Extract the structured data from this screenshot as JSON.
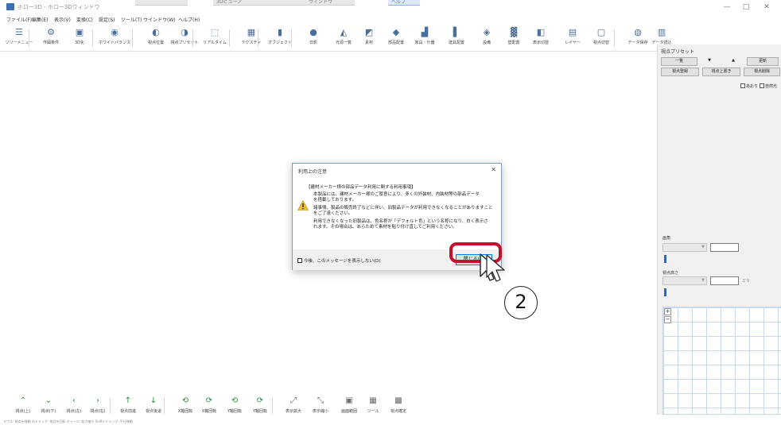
{
  "window": {
    "title": "ホロー3D - ホロー3Dウィンドウ",
    "peek_tabs": [
      "3Dビューア",
      "ウィンドウ",
      "ヘルプ"
    ],
    "controls": [
      "—",
      "□",
      "✕"
    ]
  },
  "menu": [
    "ファイル(F)",
    "編集(E)",
    "表示(V)",
    "変換(C)",
    "設定(S)",
    "ツール(T)",
    "ウインドウ(W)",
    "ヘルプ(H)"
  ],
  "toolbar": {
    "buttons": [
      {
        "icon": "menu-icon",
        "glyph": "☰",
        "label": "ツリーメニュー"
      },
      {
        "icon": "settings-icon",
        "glyph": "⚙",
        "label": "作図条件"
      },
      {
        "icon": "3d-icon",
        "glyph": "▣",
        "label": "3D化"
      },
      {
        "icon": "camera-icon",
        "glyph": "◉",
        "label": "ホワイトバランス"
      },
      {
        "icon": "viewpoint-icon",
        "glyph": "◐",
        "label": "視点位置"
      },
      {
        "icon": "preset-icon",
        "glyph": "◑",
        "label": "視点プリセット"
      },
      {
        "icon": "preview-icon",
        "glyph": "⬚",
        "label": "リアルタイム"
      },
      {
        "icon": "texture-icon",
        "glyph": "▦",
        "label": "テクスチャ"
      },
      {
        "icon": "object-icon",
        "glyph": "▮",
        "label": "オブジェクト"
      },
      {
        "icon": "sun-icon",
        "glyph": "●",
        "label": "日影"
      },
      {
        "icon": "light-icon",
        "glyph": "◭",
        "label": "光源一覧"
      },
      {
        "icon": "material-icon",
        "glyph": "◩",
        "label": "素材"
      },
      {
        "icon": "parts-icon",
        "glyph": "◆",
        "label": "部品配置"
      },
      {
        "icon": "furniture-icon",
        "glyph": "▟",
        "label": "家具・什器"
      },
      {
        "icon": "fitting-icon",
        "glyph": "▌",
        "label": "建具配置"
      },
      {
        "icon": "equipment-icon",
        "glyph": "◈",
        "label": "設備"
      },
      {
        "icon": "wall-icon",
        "glyph": "▓",
        "label": "壁配置"
      },
      {
        "icon": "display-icon",
        "glyph": "◧",
        "label": "表示切替"
      },
      {
        "icon": "layer-icon",
        "glyph": "▤",
        "label": "レイヤー"
      },
      {
        "icon": "save-view-icon",
        "glyph": "▢",
        "label": "視点切替"
      },
      {
        "icon": "data-save-icon",
        "glyph": "◍",
        "label": "データ保存"
      },
      {
        "icon": "data-load-icon",
        "glyph": "▥",
        "label": "データ読込"
      }
    ]
  },
  "right_panel": {
    "header": "視点プリセット",
    "buttons": {
      "prev": "一覧",
      "down": "▼",
      "up": "▲",
      "update": "更新",
      "register": "視点登録",
      "overwrite": "視点上書き",
      "delete": "視点削除"
    },
    "checks": [
      "あおり",
      "自然光"
    ],
    "angle_label": "画角",
    "height_label": "視点高さ",
    "height_unit": "ミリ",
    "zoom_plus": "+",
    "zoom_minus": "−"
  },
  "bottom_toolbar": {
    "buttons": [
      {
        "icon": "up-arrow-icon",
        "glyph": "⌃",
        "label": "視点(上)",
        "color": "green"
      },
      {
        "icon": "down-arrow-icon",
        "glyph": "⌄",
        "label": "視点(下)",
        "color": "green"
      },
      {
        "icon": "left-arrow-icon",
        "glyph": "‹",
        "label": "視点(左)",
        "color": "green"
      },
      {
        "icon": "right-arrow-icon",
        "glyph": "›",
        "label": "視点(右)",
        "color": "green"
      },
      {
        "icon": "forward-icon",
        "glyph": "↑",
        "label": "視点前進",
        "color": "green"
      },
      {
        "icon": "backward-icon",
        "glyph": "↓",
        "label": "視点後退",
        "color": "green"
      },
      {
        "icon": "rotate-x-icon",
        "glyph": "⟲",
        "label": "X軸回転",
        "color": "green"
      },
      {
        "icon": "rotate-x-rev-icon",
        "glyph": "⟳",
        "label": "X軸回転",
        "color": "green"
      },
      {
        "icon": "rotate-y-icon",
        "glyph": "⟲",
        "label": "Y軸回転",
        "color": "green"
      },
      {
        "icon": "rotate-y-rev-icon",
        "glyph": "⟳",
        "label": "Y軸回転",
        "color": "green"
      },
      {
        "icon": "zoom-in-icon",
        "glyph": "⤢",
        "label": "表示拡大",
        "color": "gray"
      },
      {
        "icon": "zoom-out-icon",
        "glyph": "⤡",
        "label": "表示縮小",
        "color": "gray"
      },
      {
        "icon": "fit-icon",
        "glyph": "▣",
        "label": "画面範囲",
        "color": "gray"
      },
      {
        "icon": "tool-icon",
        "glyph": "▦",
        "label": "ツール",
        "color": "gray"
      },
      {
        "icon": "reset-icon",
        "glyph": "▩",
        "label": "視点確定",
        "color": "gray"
      }
    ]
  },
  "status_text": "マウス: 視点を移動  右ドラッグ: 視点を回転  ホイール: 拡大縮小  Shift+ドラッグ: 平行移動",
  "dialog": {
    "title": "利用上の注意",
    "close": "✕",
    "heading": "【建材メーカー様の部品データ利用に関する利用事項】",
    "paragraphs": [
      "本製品には、建材メーカー様のご厚意により、多くの外装材、内装材等の部品データ",
      "を搭載しております。",
      "諸事情、製品の販売終了などに伴い、旧製品データが利用できなくなることがありますこと",
      "をご了承ください。",
      "利用できなくなった旧製品は、色名称が「デフォルト色」という名称になり、白く表示さ",
      "れます。その場合は、あらためて素材を貼り付け直してご利用ください。"
    ],
    "dont_show": "今後、このメッセージを表示しない(D)",
    "ok": "閉じる(C)"
  },
  "callout": {
    "step": "2"
  },
  "colors": {
    "highlight_ring": "#c0112d",
    "accent": "#0078d7"
  }
}
